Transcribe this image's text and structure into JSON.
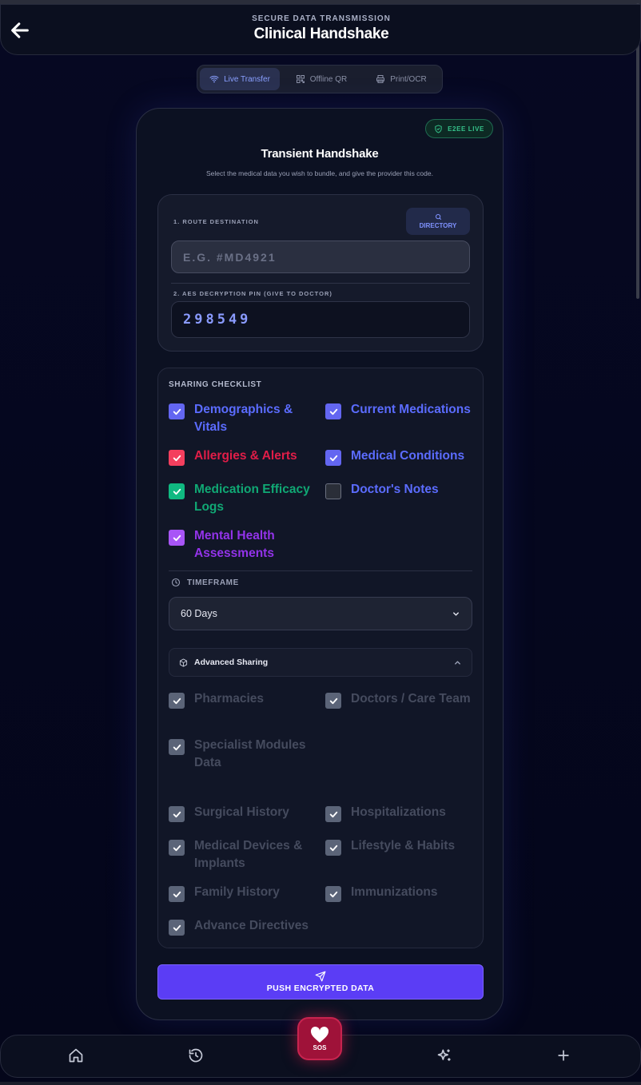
{
  "header": {
    "subtitle": "SECURE DATA TRANSMISSION",
    "title": "Clinical Handshake"
  },
  "tabs": [
    {
      "label": "Live Transfer",
      "icon": "wifi-icon",
      "active": true
    },
    {
      "label": "Offline QR",
      "icon": "qr-icon",
      "active": false
    },
    {
      "label": "Print/OCR",
      "icon": "printer-icon",
      "active": false
    }
  ],
  "card": {
    "badge": "E2EE LIVE",
    "title": "Transient Handshake",
    "description": "Select the medical data you wish to bundle, and give the provider this code."
  },
  "route": {
    "destination_label": "1. ROUTE DESTINATION",
    "directory_label": "DIRECTORY",
    "destination_placeholder": "E.G. #MD4921",
    "pin_label": "2. AES DECRYPTION PIN (GIVE TO DOCTOR)",
    "pin_value": "298549"
  },
  "checklist": {
    "title": "SHARING CHECKLIST",
    "items": [
      {
        "label": "Demographics & Vitals",
        "checked": true,
        "color": "#6366f1"
      },
      {
        "label": "Current Medications",
        "checked": true,
        "color": "#6366f1"
      },
      {
        "label": "Allergies & Alerts",
        "checked": true,
        "color": "#f43f5e"
      },
      {
        "label": "Medical Conditions",
        "checked": true,
        "color": "#6366f1"
      },
      {
        "label": "Medication Efficacy Logs",
        "checked": true,
        "color": "#10b981"
      },
      {
        "label": "Doctor's Notes",
        "checked": false,
        "color": "#6366f1"
      },
      {
        "label": "Mental Health Assessments",
        "checked": true,
        "color": "#a855f7"
      }
    ]
  },
  "timeframe": {
    "label": "TIMEFRAME",
    "selected": "60 Days"
  },
  "advanced": {
    "label": "Advanced Sharing",
    "items": [
      {
        "label": "Pharmacies",
        "checked": true
      },
      {
        "label": "Doctors / Care Team",
        "checked": true
      },
      {
        "label": "Specialist Modules Data",
        "checked": true
      },
      {
        "label": "Surgical History",
        "checked": true
      },
      {
        "label": "Hospitalizations",
        "checked": true
      },
      {
        "label": "Medical Devices & Implants",
        "checked": true
      },
      {
        "label": "Lifestyle & Habits",
        "checked": true
      },
      {
        "label": "Family History",
        "checked": true
      },
      {
        "label": "Immunizations",
        "checked": true
      },
      {
        "label": "Advance Directives",
        "checked": true
      }
    ]
  },
  "push_button": "PUSH ENCRYPTED DATA",
  "nav": {
    "sos_label": "SOS",
    "items": [
      "home-icon",
      "history-icon",
      "sparkles-icon",
      "plus-icon"
    ]
  }
}
